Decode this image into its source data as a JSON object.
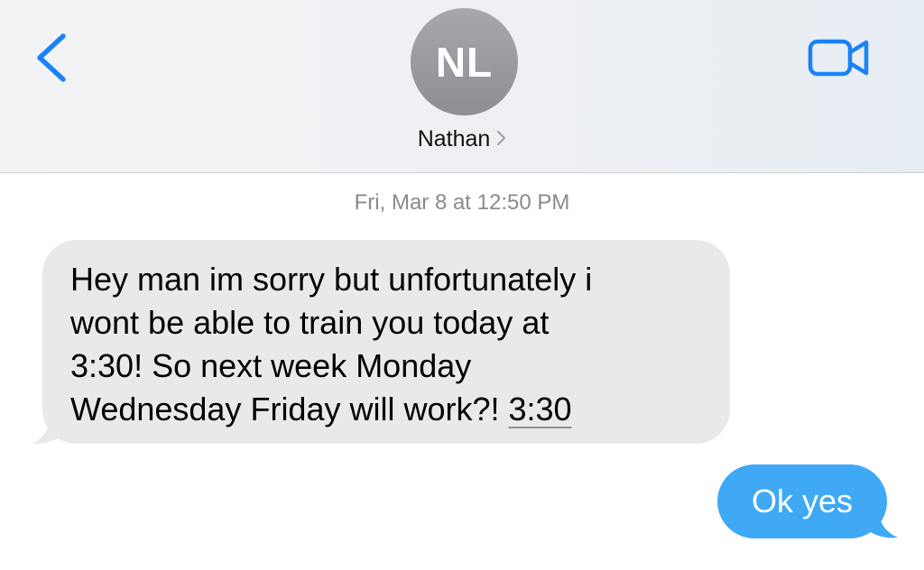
{
  "header": {
    "avatar_initials": "NL",
    "contact_name": "Nathan",
    "back_icon": "chevron-left-icon",
    "video_icon": "video-camera-icon",
    "accent_color": "#1a82f7"
  },
  "conversation": {
    "timestamp": "Fri, Mar 8 at 12:50 PM",
    "messages": [
      {
        "direction": "incoming",
        "text": "Hey man im sorry but unfortunately i\nwont be able to train you today at\n3:30! So next week Monday\nWednesday Friday will work?! ",
        "link_text": "3:30",
        "bubble_color": "#e9e9eb"
      },
      {
        "direction": "outgoing",
        "text": "Ok yes",
        "bubble_color": "#3fa9f5"
      }
    ]
  }
}
